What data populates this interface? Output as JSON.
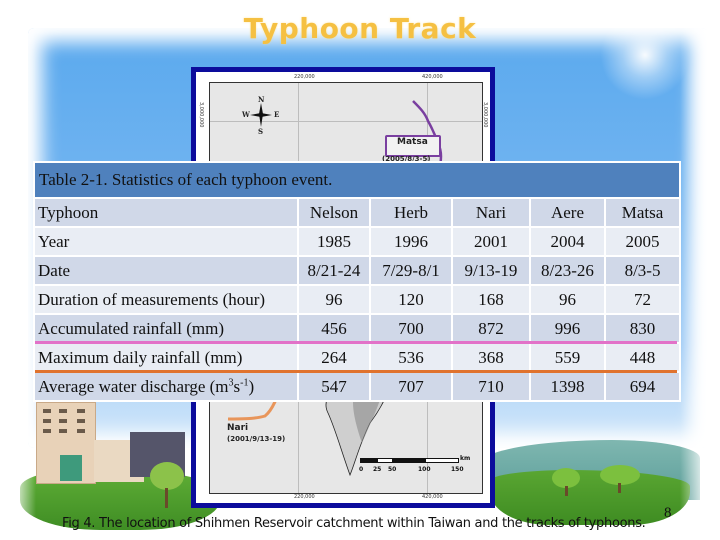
{
  "slide": {
    "title": "Typhoon Track",
    "page_number": "8"
  },
  "figure": {
    "caption": "Fig 4. The location of Shihmen Reservoir catchment within Taiwan and the tracks of typhoons.",
    "map": {
      "x_ticks": [
        "220,000",
        "420,000"
      ],
      "y_tick": "3,000,000",
      "compass": {
        "n": "N",
        "s": "S",
        "e": "E",
        "w": "W"
      },
      "tracks": [
        {
          "name": "Matsa",
          "date": "(2005/8/3-5)",
          "color": "#7a3fa0"
        },
        {
          "name": "Nari",
          "date": "(2001/9/13-19)",
          "color": "#e8955a"
        }
      ],
      "scale": {
        "labels": [
          "0",
          "25",
          "50",
          "100",
          "150"
        ],
        "unit": "km"
      }
    }
  },
  "table": {
    "caption": "Table 2-1. Statistics of each typhoon event.",
    "rows": [
      {
        "label": "Typhoon",
        "values": [
          "Nelson",
          "Herb",
          "Nari",
          "Aere",
          "Matsa"
        ]
      },
      {
        "label": "Year",
        "values": [
          "1985",
          "1996",
          "2001",
          "2004",
          "2005"
        ]
      },
      {
        "label": "Date",
        "values": [
          "8/21-24",
          "7/29-8/1",
          "9/13-19",
          "8/23-26",
          "8/3-5"
        ]
      },
      {
        "label": "Duration of measurements (hour)",
        "values": [
          "96",
          "120",
          "168",
          "96",
          "72"
        ]
      },
      {
        "label": "Accumulated rainfall (mm)",
        "values": [
          "456",
          "700",
          "872",
          "996",
          "830"
        ]
      },
      {
        "label": "Maximum daily rainfall (mm)",
        "values": [
          "264",
          "536",
          "368",
          "559",
          "448"
        ]
      },
      {
        "label_main": "Average water discharge (m",
        "label_sup1": "3",
        "label_mid": "s",
        "label_sup2": "-1",
        "label_end": ")",
        "values": [
          "547",
          "707",
          "710",
          "1398",
          "694"
        ]
      }
    ],
    "highlight_colors": {
      "accumulated_rainfall": "#e272c8",
      "max_daily_rainfall": "#e0732e"
    }
  }
}
